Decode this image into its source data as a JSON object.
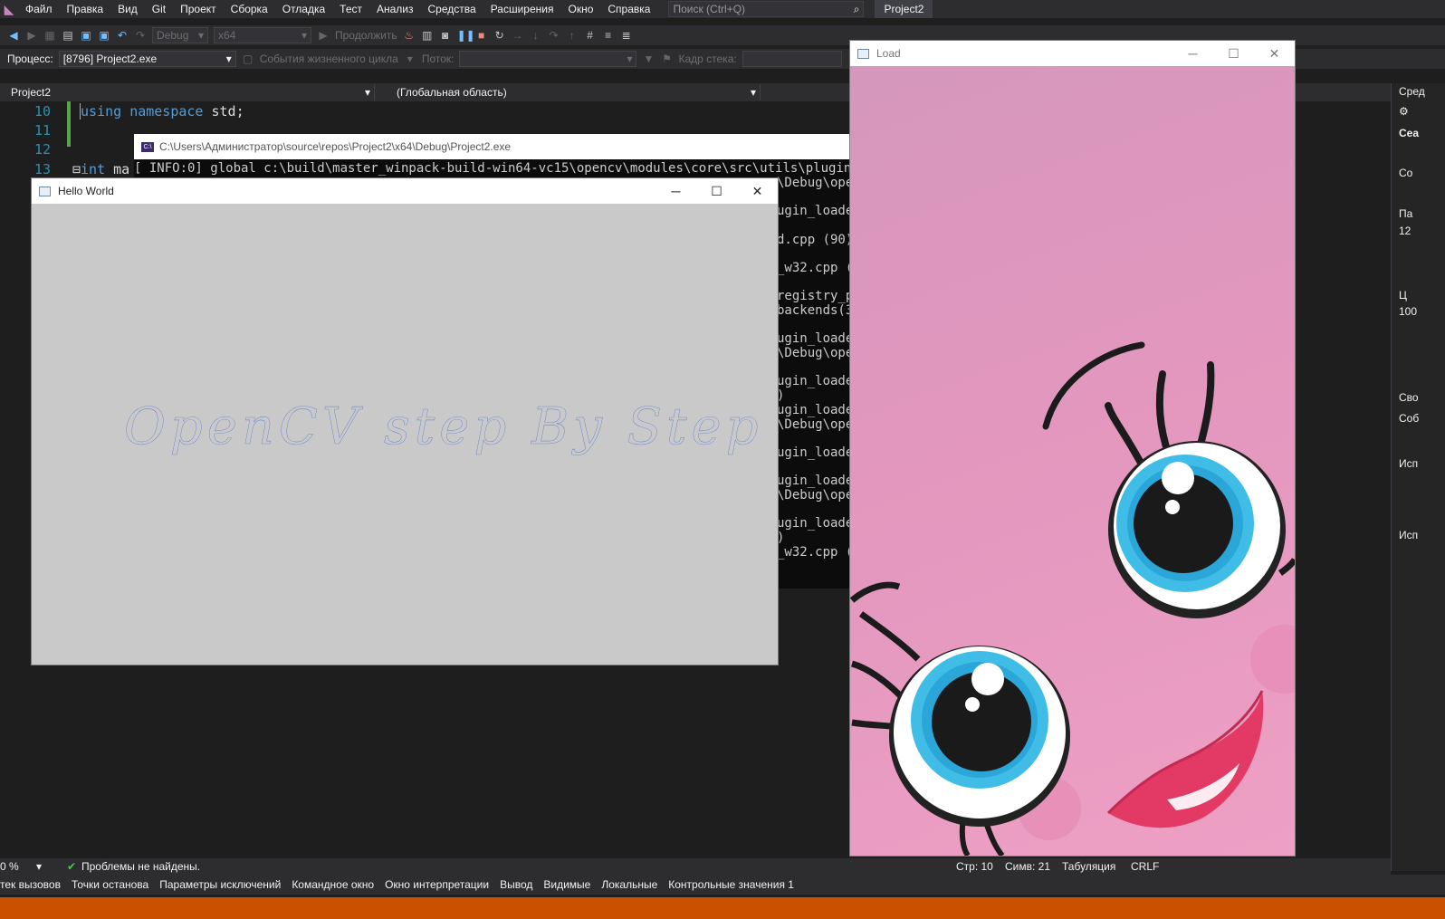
{
  "menubar": {
    "items": [
      "Файл",
      "Правка",
      "Вид",
      "Git",
      "Проект",
      "Сборка",
      "Отладка",
      "Тест",
      "Анализ",
      "Средства",
      "Расширения",
      "Окно",
      "Справка"
    ],
    "search_placeholder": "Поиск (Ctrl+Q)",
    "solution_name": "Project2"
  },
  "toolbar": {
    "configuration": "Debug",
    "platform": "x64",
    "continue_label": "Продолжить",
    "app_insights": "Application Insights"
  },
  "debug_toolbar": {
    "process_label": "Процесс:",
    "process_value": "[8796] Project2.exe",
    "lifecycle_label": "События жизненного цикла",
    "thread_label": "Поток:",
    "stack_label": "Кадр стека:"
  },
  "editor": {
    "project_combo": "Project2",
    "scope_combo": "(Глобальная область)",
    "lines": [
      {
        "no": "10",
        "text": "using namespace std;"
      },
      {
        "no": "11",
        "text": ""
      },
      {
        "no": "12",
        "text": ""
      },
      {
        "no": "13",
        "text": "int ma"
      }
    ]
  },
  "console": {
    "title": "C:\\Users\\Администратор\\source\\repos\\Project2\\x64\\Debug\\Project2.exe",
    "line0": "[ INFO:0] global c:\\build\\master_winpack-build-win64-vc15\\opencv\\modules\\core\\src\\utils\\plugin_loader",
    "fragments": [
      "\\Debug\\ope",
      "ugin_loader",
      "d.cpp (90)",
      "_w32.cpp (",
      "registry_p",
      "backends(3,",
      "ugin_loader",
      "\\Debug\\ope",
      "ugin_loader",
      ")",
      "ugin_loader",
      "\\Debug\\ope",
      "ugin_loader",
      "ugin_loader",
      "\\Debug\\ope",
      "ugin_loader",
      ")",
      "_w32.cpp ("
    ]
  },
  "hello_window": {
    "title": "Hello World",
    "text": "OpenCV step By Step"
  },
  "load_window": {
    "title": "Load"
  },
  "sidepanel": {
    "items": [
      "Сред",
      "Сеа",
      "Со",
      "Па",
      "12",
      "Ц",
      "100",
      "Сво",
      "Соб",
      "Исп",
      "Исп"
    ]
  },
  "status": {
    "zoom": "0 %",
    "problems": "Проблемы не найдены.",
    "line": "Стр: 10",
    "col": "Симв: 21",
    "indent": "Табуляция",
    "eol": "CRLF"
  },
  "bottom_tabs": [
    "тек вызовов",
    "Точки останова",
    "Параметры исключений",
    "Командное окно",
    "Окно интерпретации",
    "Вывод",
    "Видимые",
    "Локальные",
    "Контрольные значения 1"
  ],
  "colors": {
    "accent_orange": "#ca5100",
    "keyword": "#569cd6",
    "line_number": "#2b91af",
    "text_blue": "#3a5fcd",
    "load_background": "#e397be"
  }
}
